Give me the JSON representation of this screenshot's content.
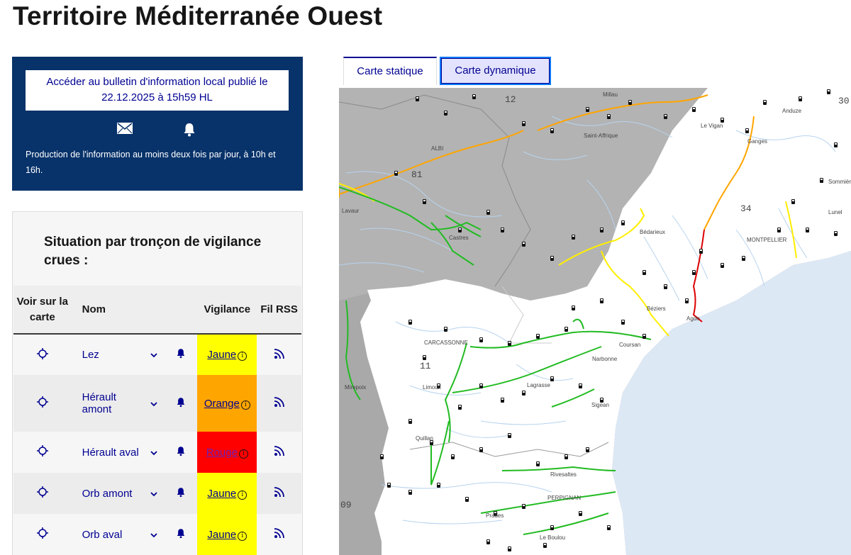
{
  "page": {
    "title": "Territoire Méditerranée Ouest"
  },
  "bulletin": {
    "link_label": "Accéder au bulletin d'information local publié le 22.12.2025 à 15h59 HL",
    "note": "Production de l'information au moins deux fois par jour, à 10h et 16h.",
    "icons": [
      "mail-icon",
      "bell-icon"
    ]
  },
  "situation": {
    "title": "Situation par tronçon de vigilance crues :",
    "headers": {
      "see": "Voir sur la carte",
      "name": "Nom",
      "vigilance": "Vigilance",
      "rss": "Fil RSS"
    },
    "rows": [
      {
        "name": "Lez",
        "vigilance": "Jaune",
        "color": "#ffff00"
      },
      {
        "name": "Hérault amont",
        "vigilance": "Orange",
        "color": "#ffa500"
      },
      {
        "name": "Hérault aval",
        "vigilance": "Rouge",
        "color": "#ff0000"
      },
      {
        "name": "Orb amont",
        "vigilance": "Jaune",
        "color": "#ffff00"
      },
      {
        "name": "Orb aval",
        "vigilance": "Jaune",
        "color": "#ffff00"
      }
    ]
  },
  "tabs": {
    "static": "Carte statique",
    "dynamic": "Carte dynamique",
    "active": "static"
  },
  "map": {
    "departments": [
      "12",
      "81",
      "34",
      "11",
      "30",
      "09"
    ],
    "towns": [
      "Millau",
      "Anduze",
      "Le Vigan",
      "Saint-Affrique",
      "ALBI",
      "Ganges",
      "Sommières",
      "Lavaur",
      "Castres",
      "Bédarieux",
      "Lunel",
      "MONTPELLIER",
      "Béziers",
      "Agde",
      "CARCASSONNE",
      "Coursan",
      "Narbonne",
      "Limoux",
      "Lagrasse",
      "Sigean",
      "Mirepoix",
      "Quillan",
      "Rivesaltes",
      "PERPIGNAN",
      "Prades",
      "Le Boulou"
    ],
    "colors": {
      "sea": "#dde8f5",
      "land": "#ffffff",
      "outside": "#a9a9a9",
      "rivers": "#b7d3ee",
      "green": "#22bb22",
      "yellow": "#ffee00",
      "orange": "#ffa500",
      "red": "#dd0000"
    }
  }
}
